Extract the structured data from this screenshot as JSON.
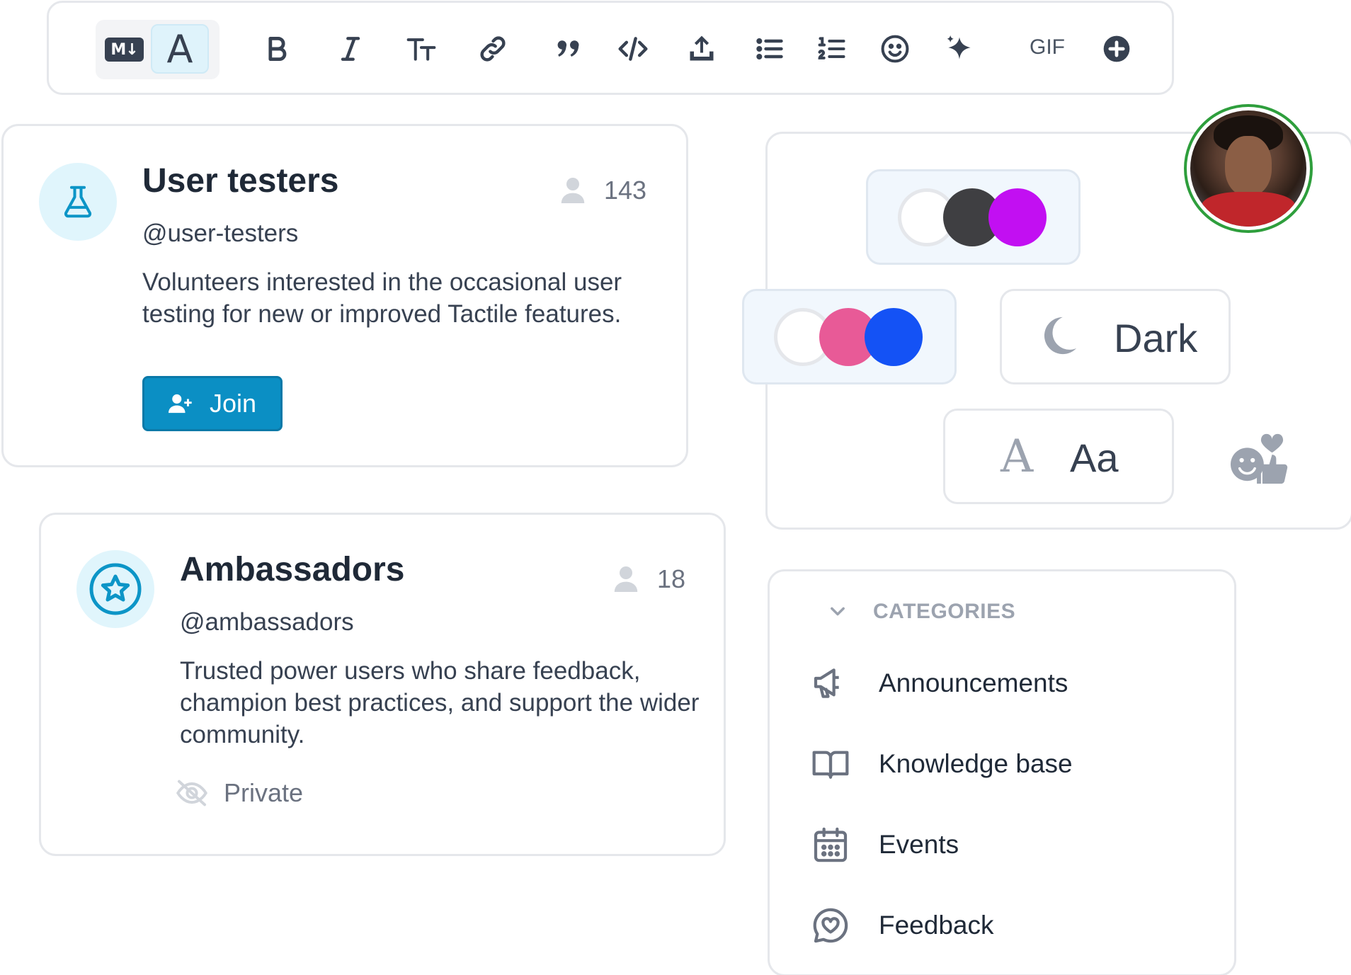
{
  "toolbar": {
    "markdown_label": "M↓",
    "text_style_label": "A",
    "gif_label": "GIF",
    "buttons": [
      "bold-icon",
      "italic-icon",
      "text-size-icon",
      "link-icon",
      "quote-icon",
      "code-icon",
      "upload-icon",
      "bullet-list-icon",
      "numbered-list-icon",
      "emoji-icon",
      "sparkle-icon",
      "gif",
      "plus-circle-icon"
    ]
  },
  "groups": [
    {
      "title": "User testers",
      "handle": "@user-testers",
      "description": "Volunteers interested in the occasional user testing for new or improved Tactile features.",
      "member_count": "143",
      "action_label": "Join",
      "icon": "flask-icon"
    },
    {
      "title": "Ambassadors",
      "handle": "@ambassadors",
      "description": "Trusted power users who share feedback, champion best practices, and support the wider community.",
      "member_count": "18",
      "visibility_label": "Private",
      "icon": "star-icon"
    }
  ],
  "theme": {
    "palette_1": [
      "#ffffff",
      "#3f3f42",
      "#c20ff2"
    ],
    "palette_2": [
      "#ffffff",
      "#e85a97",
      "#1452f5"
    ],
    "mode_label": "Dark",
    "font_label": "Aa",
    "font_icon_label": "A"
  },
  "categories": {
    "header": "CATEGORIES",
    "items": [
      {
        "label": "Announcements",
        "icon": "megaphone-icon"
      },
      {
        "label": "Knowledge base",
        "icon": "book-icon"
      },
      {
        "label": "Events",
        "icon": "calendar-icon"
      },
      {
        "label": "Feedback",
        "icon": "chat-heart-icon"
      }
    ]
  },
  "colors": {
    "accent": "#0b8fc4",
    "avatar_ring": "#2e9e3c"
  }
}
